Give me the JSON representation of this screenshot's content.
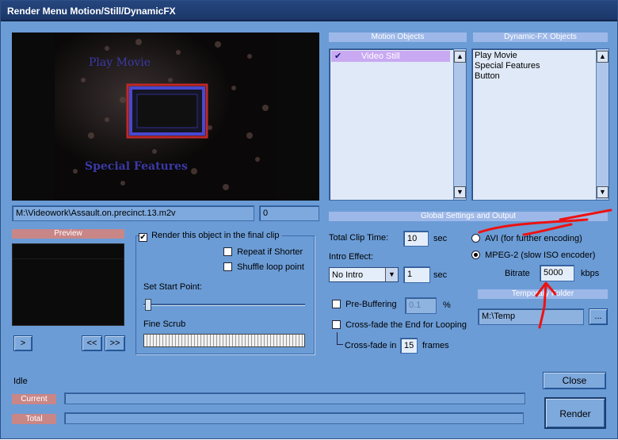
{
  "title": "Render Menu Motion/Still/DynamicFX",
  "preview_main": {
    "text1": "Play Movie",
    "text2": "Special Features"
  },
  "file_path": "M:\\Videowork\\Assault.on.precinct.13.m2v",
  "frame_value": "0",
  "motion_objects": {
    "header": "Motion Objects",
    "items": [
      "Video Still"
    ]
  },
  "dynamic_fx": {
    "header": "Dynamic-FX Objects",
    "items": [
      "Play Movie",
      "Special Features",
      "Button"
    ]
  },
  "preview_small": {
    "header": "Preview",
    "play_label": ">",
    "rewind_label": "<<",
    "forward_label": ">>"
  },
  "render_opts": {
    "render_label": "Render this object in the final clip",
    "repeat_label": "Repeat if Shorter",
    "shuffle_label": "Shuffle loop point",
    "start_label": "Set Start Point:",
    "scrub_label": "Fine Scrub"
  },
  "global": {
    "header": "Global Settings and Output",
    "clip_time_label": "Total Clip Time:",
    "clip_time_value": "10",
    "sec1": "sec",
    "intro_label": "Intro Effect:",
    "intro_value": "No Intro",
    "intro_sec_value": "1",
    "sec2": "sec",
    "prebuffer_label": "Pre-Buffering",
    "prebuffer_value": "0.1",
    "percent": "%",
    "crossfade_label": "Cross-fade the End for Looping",
    "crossfade_in_label": "Cross-fade in",
    "crossfade_frames": "15",
    "frames_label": "frames",
    "avi_label": "AVI (for further encoding)",
    "mpeg_label": "MPEG-2 (slow ISO encoder)",
    "bitrate_label": "Bitrate",
    "bitrate_value": "5000",
    "kbps": "kbps",
    "temp_header": "Temporary Folder",
    "temp_value": "M:\\Temp",
    "browse_label": "..."
  },
  "status": {
    "state": "Idle",
    "current_label": "Current",
    "total_label": "Total",
    "current_progress": 0,
    "total_progress": 0
  },
  "buttons": {
    "close": "Close",
    "render": "Render"
  },
  "colors": {
    "annotation": "#ee1111"
  }
}
